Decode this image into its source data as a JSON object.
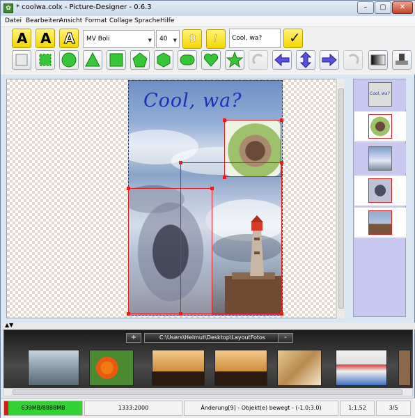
{
  "window": {
    "title": "* coolwa.colx - Picture-Designer - 0.6.3",
    "buttons": [
      "–",
      "▢",
      "✕"
    ]
  },
  "menu": [
    "Datei",
    "Bearbeiten",
    "Ansicht",
    "Format",
    "Collage",
    "Sprache",
    "Hilfe"
  ],
  "toolbar": {
    "font": "MV Boli",
    "size": "40",
    "text_value": "Cool, wa?",
    "bold_label": "B",
    "italic_label": "I",
    "text_icon_label": "A",
    "check_label": "✓"
  },
  "canvas": {
    "headline": "Cool,  wa?"
  },
  "right_panel": {
    "first_thumb_text": "Cool, wa?"
  },
  "gallery": {
    "add_label": "+",
    "path": "C:\\Users\\Helmut\\Desktop\\LayoutFotos",
    "remove_label": "-"
  },
  "status": {
    "memory": "639MB/8888MB",
    "dimensions": "1333:2000",
    "change": "Änderung[9] - Objekt(e) bewegt - (-1.0:3.0)",
    "ratio": "1:1,52",
    "count": "3/5"
  },
  "colors": {
    "accent_yellow": "#f3d600",
    "selection_red": "#e02020",
    "headline_blue": "#1e2fb8",
    "panel_lilac": "#c9c8f0",
    "memory_green": "#33d233"
  }
}
